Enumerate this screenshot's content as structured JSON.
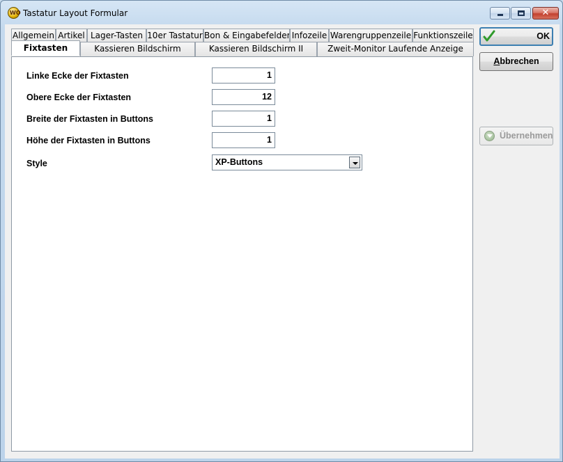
{
  "window": {
    "title": "Tastatur Layout Formular",
    "app_icon_text": "WO"
  },
  "tabs_row1": [
    {
      "label": "Allgemein"
    },
    {
      "label": "Artikel"
    },
    {
      "label": "Lager-Tasten"
    },
    {
      "label": "10er Tastatur"
    },
    {
      "label": "Bon & Eingabefelder"
    },
    {
      "label": "Infozeile"
    },
    {
      "label": "Warengruppenzeile"
    },
    {
      "label": "Funktionszeile"
    }
  ],
  "tabs_row2": [
    {
      "label": "Fixtasten",
      "active": true
    },
    {
      "label": "Kassieren Bildschirm"
    },
    {
      "label": "Kassieren Bildschirm II"
    },
    {
      "label": "Zweit-Monitor Laufende Anzeige"
    }
  ],
  "form": {
    "fields": [
      {
        "label": "Linke Ecke der Fixtasten",
        "value": "1"
      },
      {
        "label": "Obere Ecke der Fixtasten",
        "value": "12"
      },
      {
        "label": "Breite der Fixtasten in Buttons",
        "value": "1"
      },
      {
        "label": "Höhe der Fixtasten in Buttons",
        "value": "1"
      }
    ],
    "style": {
      "label": "Style",
      "value": "XP-Buttons"
    }
  },
  "buttons": {
    "ok": "OK",
    "cancel": "Abbrechen",
    "apply": "Übernehmen"
  },
  "colors": {
    "title_bar": "#c4d9ee",
    "close_button": "#c2412f",
    "focus_border": "#3c7fb1",
    "disabled_text": "#9a9a9a"
  }
}
